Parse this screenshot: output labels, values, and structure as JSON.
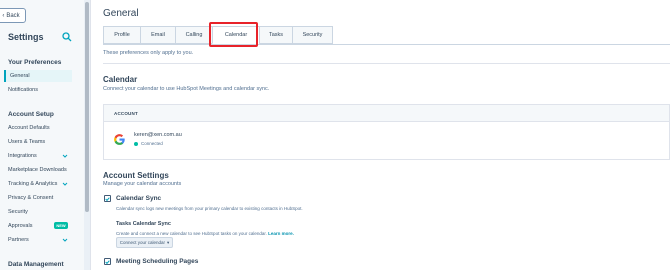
{
  "sidebar": {
    "back_label": "Back",
    "title": "Settings",
    "sections": [
      {
        "title": "Your Preferences",
        "items": [
          {
            "label": "General"
          },
          {
            "label": "Notifications"
          }
        ]
      },
      {
        "title": "Account Setup",
        "items": [
          {
            "label": "Account Defaults"
          },
          {
            "label": "Users & Teams"
          },
          {
            "label": "Integrations"
          },
          {
            "label": "Marketplace Downloads"
          },
          {
            "label": "Tracking & Analytics"
          },
          {
            "label": "Privacy & Consent"
          },
          {
            "label": "Security"
          },
          {
            "label": "Approvals",
            "badge": "NEW"
          },
          {
            "label": "Partners"
          }
        ]
      },
      {
        "title": "Data Management"
      }
    ]
  },
  "main": {
    "title": "General",
    "tabs": [
      {
        "label": "Profile"
      },
      {
        "label": "Email"
      },
      {
        "label": "Calling"
      },
      {
        "label": "Calendar"
      },
      {
        "label": "Tasks"
      },
      {
        "label": "Security"
      }
    ],
    "preferences_note": "These preferences only apply to you.",
    "calendar": {
      "title": "Calendar",
      "subtitle": "Connect your calendar to use HubSpot Meetings and calendar sync.",
      "account_header": "ACCOUNT",
      "email": "keren@xen.com.au",
      "status": "Connected"
    },
    "account_settings": {
      "title": "Account Settings",
      "subtitle": "Manage your calendar accounts",
      "calendar_sync_label": "Calendar Sync",
      "calendar_sync_desc": "Calendar sync logs new meetings from your primary calendar to existing contacts in HubSpot.",
      "tasks_sync_label": "Tasks Calendar Sync",
      "tasks_sync_desc": "Create and connect a new calendar to see HubSpot tasks on your calendar.",
      "learn_more": "Learn more.",
      "connect_button": "Connect your calendar",
      "meeting_pages_label": "Meeting Scheduling Pages"
    }
  },
  "colors": {
    "accent": "#00a4bd",
    "highlight": "#e8232a",
    "connected": "#00bda5",
    "link": "#0091ae"
  }
}
